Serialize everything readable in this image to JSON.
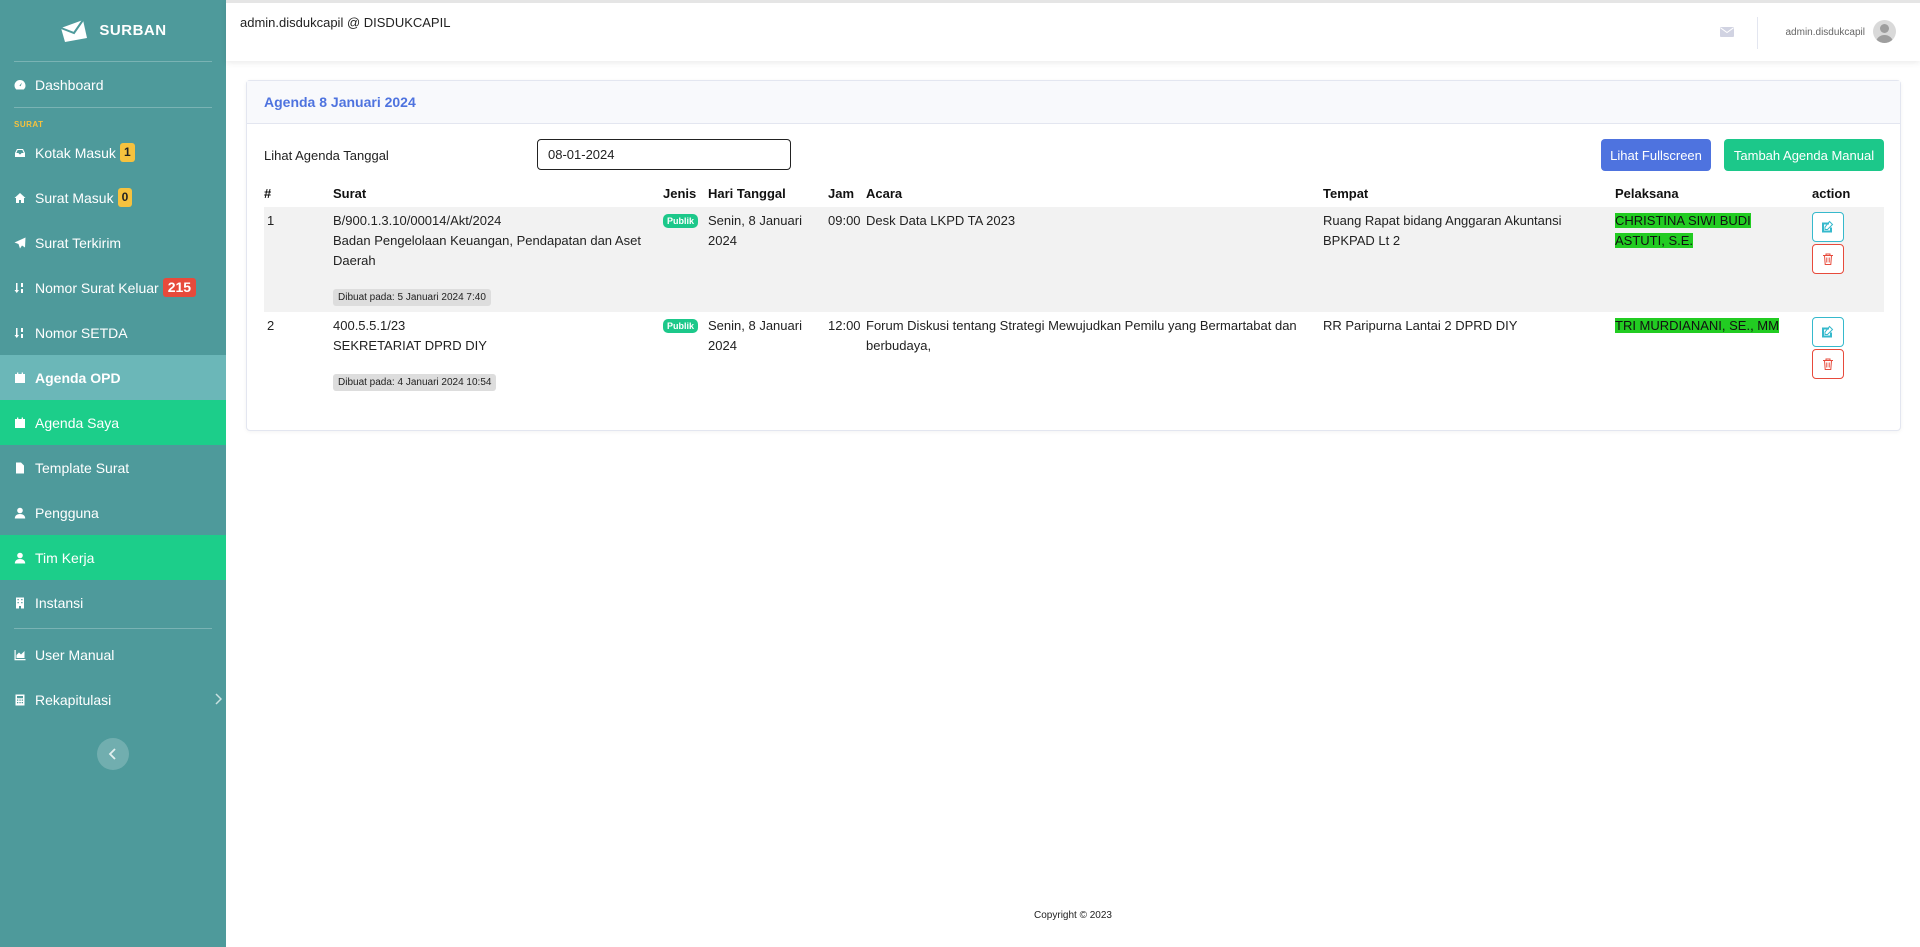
{
  "sidebar": {
    "brand": "SURBAN",
    "items": [
      {
        "label": "Dashboard"
      },
      {
        "label": "Kotak Masuk",
        "badge": "1"
      },
      {
        "label": "Surat Masuk",
        "badge": "0"
      },
      {
        "label": "Surat Terkirim"
      },
      {
        "label": "Nomor Surat Keluar",
        "badge": "215"
      },
      {
        "label": "Nomor SETDA"
      },
      {
        "label": "Agenda OPD"
      },
      {
        "label": "Agenda Saya"
      },
      {
        "label": "Template Surat"
      },
      {
        "label": "Pengguna"
      },
      {
        "label": "Tim Kerja"
      },
      {
        "label": "Instansi"
      },
      {
        "label": "User Manual"
      },
      {
        "label": "Rekapitulasi"
      }
    ],
    "section_label": "SURAT"
  },
  "topbar": {
    "user_org": "admin.disdukcapil @ DISDUKCAPIL",
    "username": "admin.disdukcapil"
  },
  "card": {
    "title": "Agenda 8 Januari 2024",
    "filter_label": "Lihat Agenda Tanggal",
    "date_value": "08-01-2024",
    "btn_fullscreen": "Lihat Fullscreen",
    "btn_add": "Tambah Agenda Manual"
  },
  "table": {
    "headers": [
      "#",
      "Surat",
      "Jenis",
      "Hari Tanggal",
      "Jam",
      "Acara",
      "Tempat",
      "Pelaksana",
      "action"
    ],
    "rows": [
      {
        "no": "1",
        "surat_no": "B/900.1.3.10/00014/Akt/2024",
        "surat_org": "Badan Pengelolaan Keuangan, Pendapatan dan Aset Daerah",
        "created": "Dibuat pada: 5 Januari 2024 7:40",
        "jenis": "Publik",
        "hari": "Senin, 8 Januari 2024",
        "jam": "09:00",
        "acara": "Desk Data LKPD TA 2023",
        "tempat": "Ruang Rapat bidang Anggaran Akuntansi BPKPAD Lt 2",
        "pelaksana": "CHRISTINA SIWI BUDI ASTUTI, S.E."
      },
      {
        "no": "2",
        "surat_no": "400.5.5.1/23",
        "surat_org": "SEKRETARIAT DPRD DIY",
        "created": "Dibuat pada: 4 Januari 2024 10:54",
        "jenis": "Publik",
        "hari": "Senin, 8 Januari 2024",
        "jam": "12:00",
        "acara": "Forum Diskusi tentang Strategi Mewujudkan Pemilu yang Bermartabat dan berbudaya,",
        "tempat": "RR Paripurna Lantai 2 DPRD DIY",
        "pelaksana": "TRI MURDIANANI, SE., MM"
      }
    ]
  },
  "footer": {
    "copyright": "Copyright © 2023"
  },
  "colors": {
    "sidebar": "#4e9a9b",
    "active": "#6bb7b8",
    "green": "#1cce8a",
    "primary": "#4e73df",
    "success": "#1cc88a",
    "highlight": "#22cc22"
  }
}
